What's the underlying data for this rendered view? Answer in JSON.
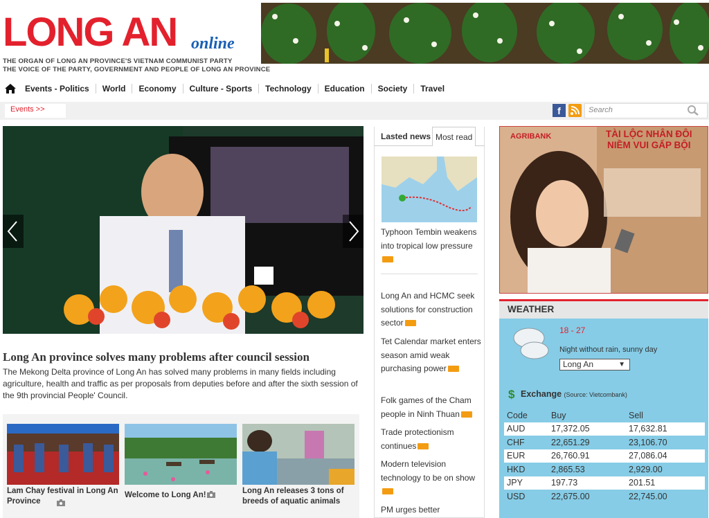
{
  "header": {
    "logo_main": "LONG AN",
    "logo_sub": "online",
    "tagline_1": "THE ORGAN OF LONG AN PROVINCE'S VIETNAM COMMUNIST PARTY",
    "tagline_2": "THE VOICE OF THE PARTY, GOVERNMENT AND PEOPLE OF LONG AN PROVINCE"
  },
  "nav": {
    "items": [
      "Events - Politics",
      "World",
      "Economy",
      "Culture - Sports",
      "Technology",
      "Education",
      "Society",
      "Travel"
    ]
  },
  "subbar": {
    "events_label": "Events >>",
    "facebook_label": "f",
    "search_placeholder": "Search"
  },
  "hero": {
    "title": "Long An province solves many problems after council session",
    "summary": "The Mekong Delta province of Long An has solved many problems in many fields including agriculture, health and traffic as per proposals from deputies before and after the sixth session of the 9th provincial People' Council."
  },
  "thumbs": [
    {
      "caption": "Lam Chay festival in Long An Province"
    },
    {
      "caption": "Welcome to Long An!"
    },
    {
      "caption": "Long An releases 3 tons of breeds of aquatic animals"
    }
  ],
  "latest": {
    "tab_latest": "Lasted news",
    "tab_most": "Most read",
    "items": [
      "Typhoon Tembin weakens into tropical low pressure",
      "Long An and HCMC seek solutions for construction sector",
      "Tet Calendar market enters season amid weak purchasing power",
      "Folk games of the Cham people in Ninh Thuan",
      "Trade protectionism continues",
      "Modern television technology to be on show",
      "PM urges better"
    ]
  },
  "ad": {
    "brand": "AGRIBANK",
    "headline_1": "TÀI LỘC NHÂN ĐÔI",
    "headline_2": "NIỀM VUI GẤP BỘI"
  },
  "weather": {
    "title": "WEATHER",
    "temp": "18 - 27",
    "desc": "Night without rain, sunny day",
    "location": "Long An",
    "exchange_title": "Exchange",
    "exchange_source": "(Source: Vietcombank)",
    "headers": [
      "Code",
      "Buy",
      "Sell"
    ],
    "rows": [
      [
        "AUD",
        "17,372.05",
        "17,632.81"
      ],
      [
        "CHF",
        "22,651.29",
        "23,106.70"
      ],
      [
        "EUR",
        "26,760.91",
        "27,086.04"
      ],
      [
        "HKD",
        "2,865.53",
        "2,929.00"
      ],
      [
        "JPY",
        "197.73",
        "201.51"
      ],
      [
        "USD",
        "22,675.00",
        "22,745.00"
      ]
    ]
  },
  "colors": {
    "brand_red": "#e3212d",
    "weather_blue": "#86cce6"
  }
}
